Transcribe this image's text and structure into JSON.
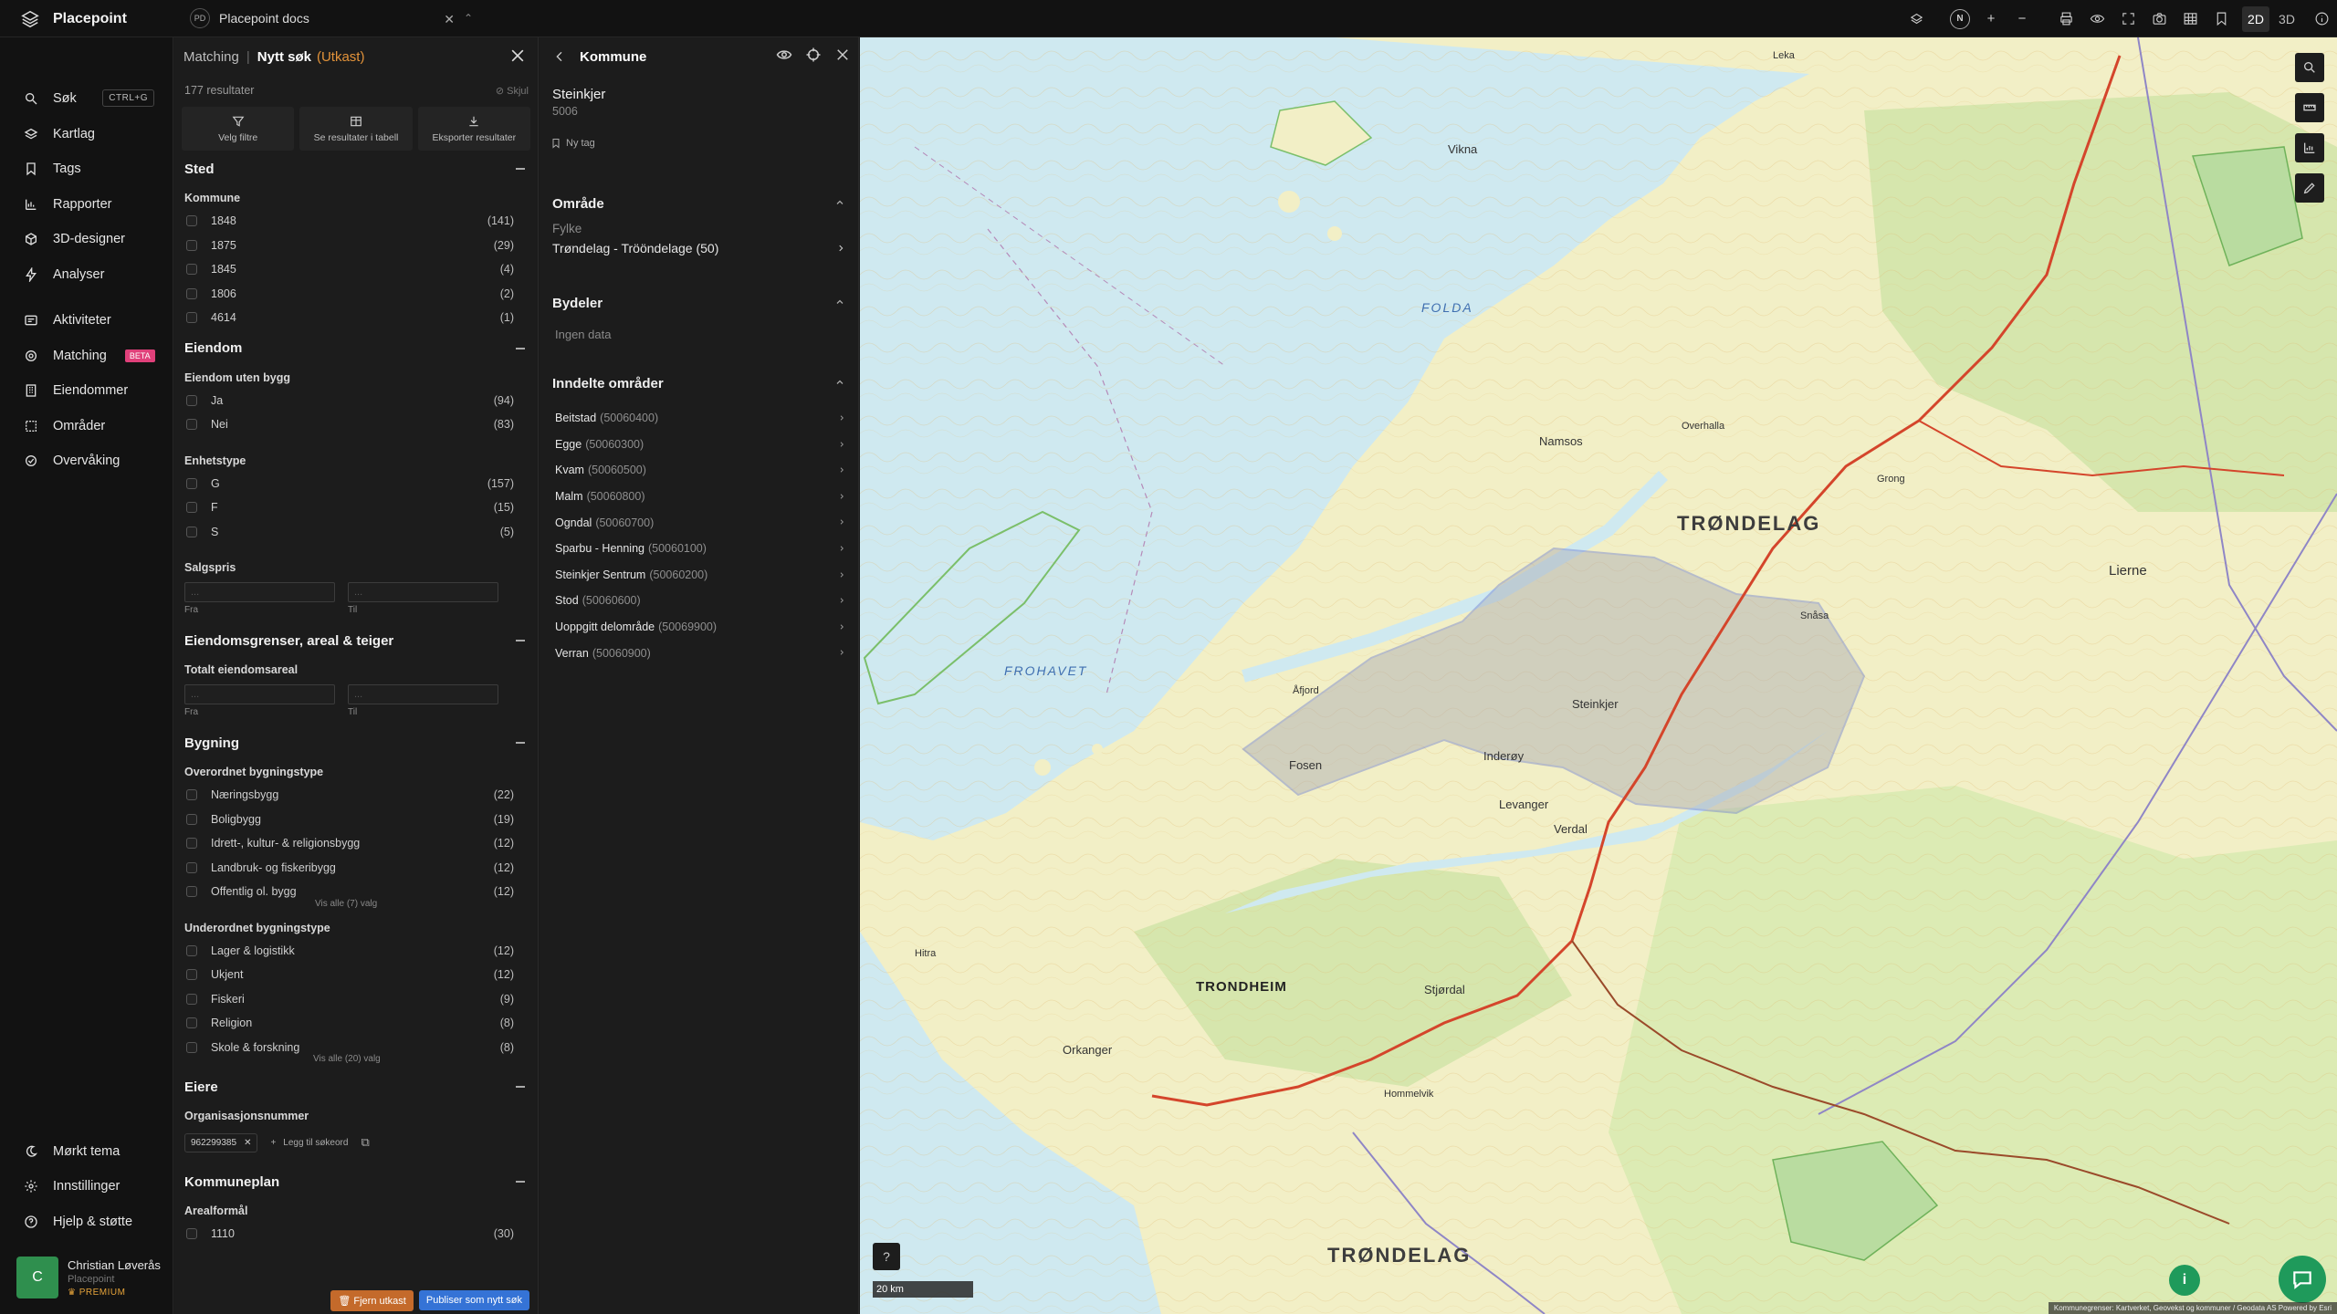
{
  "app": {
    "name": "Placepoint",
    "workspace": "Placepoint docs",
    "workspace_initials": "PD"
  },
  "top_tools": {
    "north": "N",
    "view_2d": "2D",
    "view_3d": "3D"
  },
  "nav": {
    "items": [
      {
        "label": "Søk",
        "icon": "search-icon",
        "kbd": "CTRL+G"
      },
      {
        "label": "Kartlag",
        "icon": "layers-icon"
      },
      {
        "label": "Tags",
        "icon": "bookmark-icon"
      },
      {
        "label": "Rapporter",
        "icon": "chart-icon"
      },
      {
        "label": "3D-designer",
        "icon": "cube-icon"
      },
      {
        "label": "Analyser",
        "icon": "bolt-icon"
      }
    ],
    "items2": [
      {
        "label": "Aktiviteter",
        "icon": "activity-icon"
      },
      {
        "label": "Matching",
        "icon": "target-icon",
        "badge": "BETA"
      },
      {
        "label": "Eiendommer",
        "icon": "building-icon"
      },
      {
        "label": "Områder",
        "icon": "area-icon"
      },
      {
        "label": "Overvåking",
        "icon": "monitor-icon"
      }
    ],
    "bottom": [
      {
        "label": "Mørkt tema",
        "icon": "moon-icon"
      },
      {
        "label": "Innstillinger",
        "icon": "gear-icon"
      },
      {
        "label": "Hjelp & støtte",
        "icon": "help-icon"
      }
    ],
    "user": {
      "initial": "C",
      "name": "Christian Løverås",
      "org": "Placepoint",
      "plan": "PREMIUM"
    }
  },
  "matching": {
    "crumb": "Matching",
    "separator": "|",
    "title": "Nytt søk",
    "draft": "(Utkast)",
    "count": "177 resultater",
    "hide": "Skjul",
    "actions": [
      "Velg filtre",
      "Se resultater i tabell",
      "Eksporter resultater"
    ],
    "sections": {
      "sted": {
        "title": "Sted",
        "kommune_label": "Kommune",
        "kommune": [
          {
            "label": "1848",
            "count": "(141)"
          },
          {
            "label": "1875",
            "count": "(29)"
          },
          {
            "label": "1845",
            "count": "(4)"
          },
          {
            "label": "1806",
            "count": "(2)"
          },
          {
            "label": "4614",
            "count": "(1)"
          }
        ]
      },
      "eiendom": {
        "title": "Eiendom",
        "uten_bygg_label": "Eiendom uten bygg",
        "uten_bygg": [
          {
            "label": "Ja",
            "count": "(94)"
          },
          {
            "label": "Nei",
            "count": "(83)"
          }
        ],
        "enhetstype_label": "Enhetstype",
        "enhetstype": [
          {
            "label": "G",
            "count": "(157)"
          },
          {
            "label": "F",
            "count": "(15)"
          },
          {
            "label": "S",
            "count": "(5)"
          }
        ],
        "salgspris_label": "Salgspris",
        "from_label": "Fra",
        "to_label": "Til",
        "placeholder": "..."
      },
      "grenser": {
        "title": "Eiendomsgrenser, areal & teiger",
        "areal_label": "Totalt eiendomsareal",
        "from_label": "Fra",
        "to_label": "Til",
        "placeholder": "..."
      },
      "bygning": {
        "title": "Bygning",
        "over_label": "Overordnet bygningstype",
        "over": [
          {
            "label": "Næringsbygg",
            "count": "(22)"
          },
          {
            "label": "Boligbygg",
            "count": "(19)"
          },
          {
            "label": "Idrett-, kultur- & religionsbygg",
            "count": "(12)"
          },
          {
            "label": "Landbruk- og fiskeribygg",
            "count": "(12)"
          },
          {
            "label": "Offentlig ol. bygg",
            "count": "(12)"
          }
        ],
        "over_showall": "Vis alle (7) valg",
        "under_label": "Underordnet bygningstype",
        "under": [
          {
            "label": "Lager & logistikk",
            "count": "(12)"
          },
          {
            "label": "Ukjent",
            "count": "(12)"
          },
          {
            "label": "Fiskeri",
            "count": "(9)"
          },
          {
            "label": "Religion",
            "count": "(8)"
          },
          {
            "label": "Skole & forskning",
            "count": "(8)"
          }
        ],
        "under_showall": "Vis alle (20) valg"
      },
      "eiere": {
        "title": "Eiere",
        "org_label": "Organisasjonsnummer",
        "chip": "962299385",
        "add_keyword": "Legg til søkeord"
      },
      "kommuneplan": {
        "title": "Kommuneplan",
        "areal_label": "Arealformål",
        "first": {
          "label": "1110",
          "count": "(30)"
        }
      }
    },
    "footer": {
      "remove": "Fjern utkast",
      "publish": "Publiser som nytt søk"
    }
  },
  "kommune": {
    "header": "Kommune",
    "name": "Steinkjer",
    "code": "5006",
    "tag": "Ny tag",
    "omrade_title": "Område",
    "fylke_label": "Fylke",
    "fylke_value": "Trøndelag - Trööndelage (50)",
    "bydeler_title": "Bydeler",
    "bydeler_empty": "Ingen data",
    "inndelte_title": "Inndelte områder",
    "inndelte": [
      {
        "name": "Beitstad",
        "code": "(50060400)"
      },
      {
        "name": "Egge",
        "code": "(50060300)"
      },
      {
        "name": "Kvam",
        "code": "(50060500)"
      },
      {
        "name": "Malm",
        "code": "(50060800)"
      },
      {
        "name": "Ogndal",
        "code": "(50060700)"
      },
      {
        "name": "Sparbu - Henning",
        "code": "(50060100)"
      },
      {
        "name": "Steinkjer Sentrum",
        "code": "(50060200)"
      },
      {
        "name": "Stod",
        "code": "(50060600)"
      },
      {
        "name": "Uoppgitt delområde",
        "code": "(50069900)"
      },
      {
        "name": "Verran",
        "code": "(50060900)"
      }
    ]
  },
  "map": {
    "labels": {
      "trondelag_north": "TRØNDELAG",
      "trondelag_south": "TRØNDELAG",
      "folda": "FOLDA",
      "frohavet": "FROHAVET",
      "trondheim": "TRONDHEIM",
      "lierne": "Lierne",
      "vikna": "Vikna",
      "namsos": "Namsos",
      "steinkjer": "Steinkjer",
      "levanger": "Levanger",
      "verdal": "Verdal",
      "fosen": "Fosen",
      "inderoy": "Inderøy",
      "orkanger": "Orkanger",
      "stjordal": "Stjørdal",
      "snasa": "Snåsa",
      "grong": "Grong",
      "leka": "Leka",
      "hitra": "Hitra",
      "afjord": "Åfjord",
      "overhalla": "Overhalla",
      "malvik": "Hommelvik"
    },
    "scale": "20 km",
    "attribution": "Kommunegrenser: Kartverket, Geovekst og kommuner / Geodata AS Powered by Esri",
    "colors": {
      "water": "#cfe9f0",
      "land": "#f2efc6",
      "forest": "#cfe3a6",
      "road": "#d4452b",
      "region": "#8f86c6"
    }
  }
}
